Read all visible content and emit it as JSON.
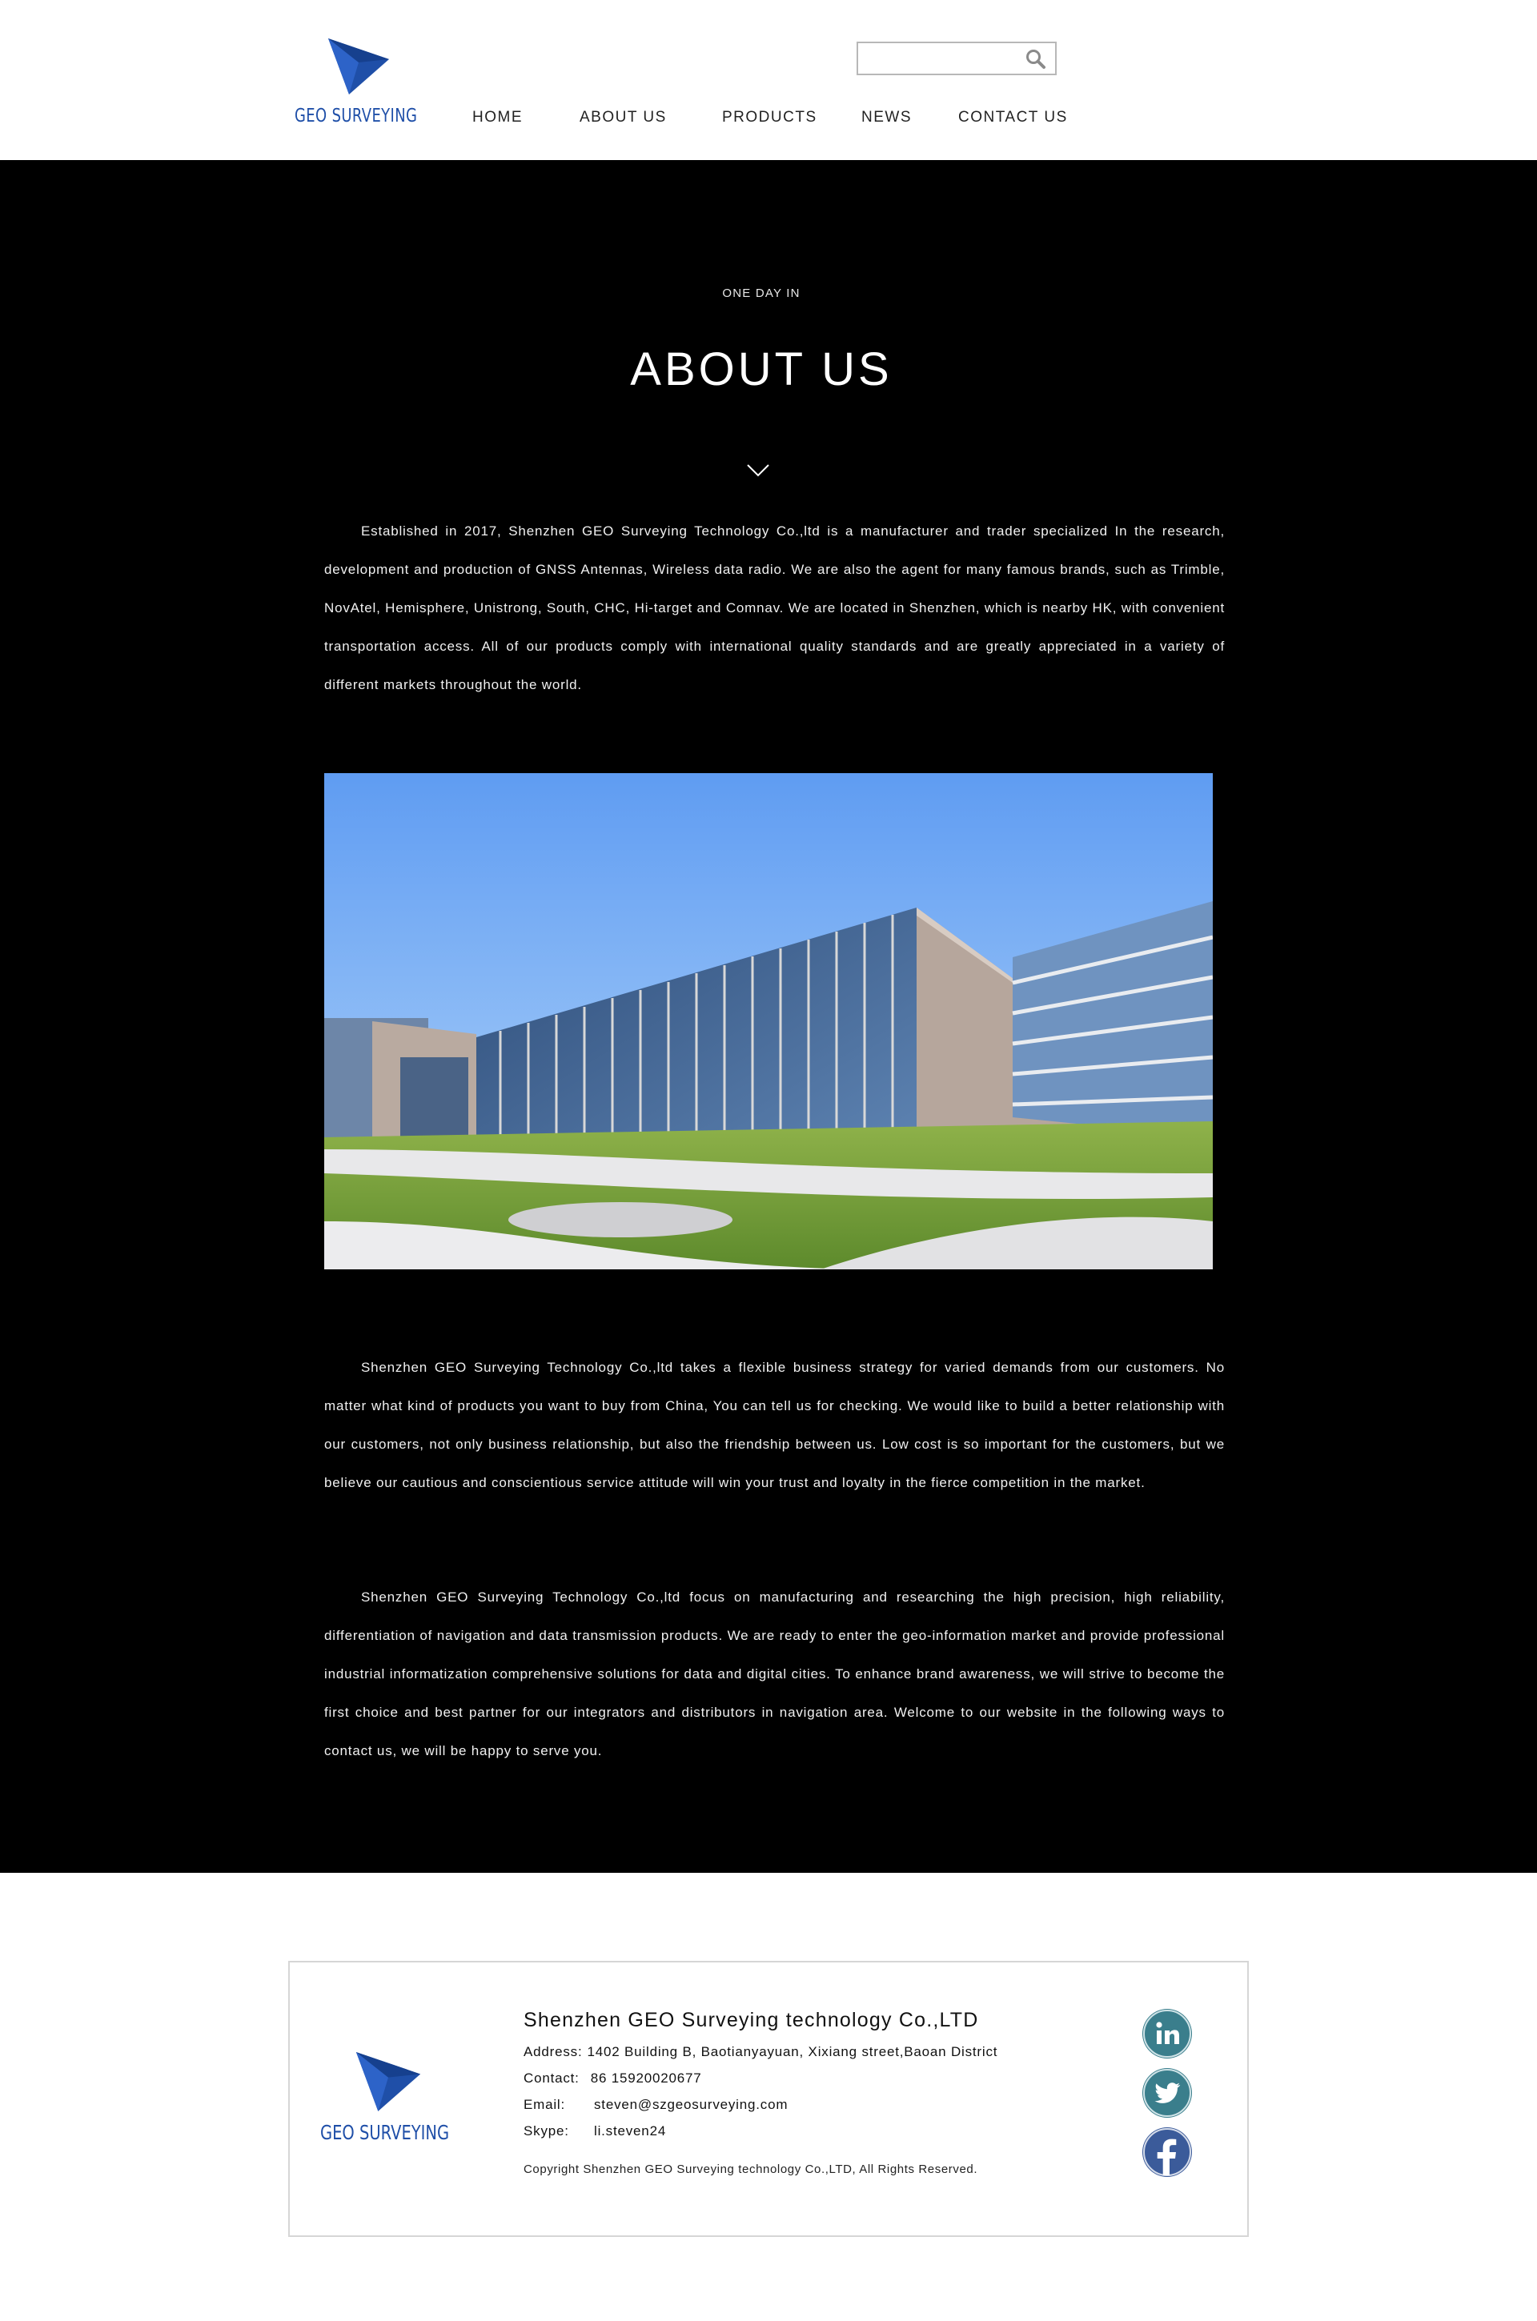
{
  "header": {
    "logo_text": "GEO SURVEYING",
    "search": {
      "value": "",
      "placeholder": ""
    },
    "search_icon": "search-icon",
    "nav": [
      {
        "label": "HOME"
      },
      {
        "label": "ABOUT US"
      },
      {
        "label": "PRODUCTS"
      },
      {
        "label": "NEWS"
      },
      {
        "label": "CONTACT US"
      }
    ]
  },
  "about": {
    "kicker": "ONE DAY IN",
    "title": "ABOUT US",
    "scroll_icon": "chevron-down-icon",
    "paragraphs": [
      "Established in 2017, Shenzhen GEO Surveying Technology Co.,ltd is a manufacturer and trader specialized In the research, development and production of GNSS Antennas, Wireless data radio. We are also the agent for many famous brands, such as Trimble, NovAtel, Hemisphere, Unistrong, South, CHC, Hi-target and Comnav. We are located in Shenzhen, which is nearby HK, with convenient transportation access. All of our products comply with international quality standards and are greatly appreciated in a variety of different markets throughout the world.",
      "Shenzhen GEO Surveying Technology Co.,ltd takes a flexible business strategy for varied demands from our customers. No matter what kind of products you want to buy from China, You can tell us for checking. We would like to build a better relationship with our customers, not only business relationship, but also the friendship between us. Low cost is so important for the customers, but we believe our cautious and conscientious service attitude will win your trust and loyalty in the fierce competition in the market.",
      "Shenzhen GEO Surveying Technology Co.,ltd focus on manufacturing and researching the high precision, high reliability, differentiation of navigation and data transmission products. We are ready to enter the geo-information market and provide professional industrial informatization comprehensive solutions for data and digital cities.  To enhance brand awareness, we will strive to become the first choice and best partner for our integrators and distributors in navigation area. Welcome to our website in the following ways to contact us, we will be happy to serve you."
    ]
  },
  "footer": {
    "logo_text": "GEO SURVEYING",
    "company": "Shenzhen GEO Surveying technology Co.,LTD",
    "address_label": "Address:",
    "address": "1402 Building B, Baotianyayuan, Xixiang street,Baoan District",
    "contact_label": "Contact:",
    "contact": "86 15920020677",
    "email_label": "Email:",
    "email": "steven@szgeosurveying.com",
    "skype_label": "Skype:",
    "skype": "li.steven24",
    "copyright": "Copyright Shenzhen GEO Surveying technology Co.,LTD, All Rights Reserved.",
    "social": [
      {
        "icon": "linkedin-icon",
        "color": "#3a7e8c"
      },
      {
        "icon": "twitter-icon",
        "color": "#3a7e8c"
      },
      {
        "icon": "facebook-icon",
        "color": "#3b5b9a"
      }
    ]
  }
}
